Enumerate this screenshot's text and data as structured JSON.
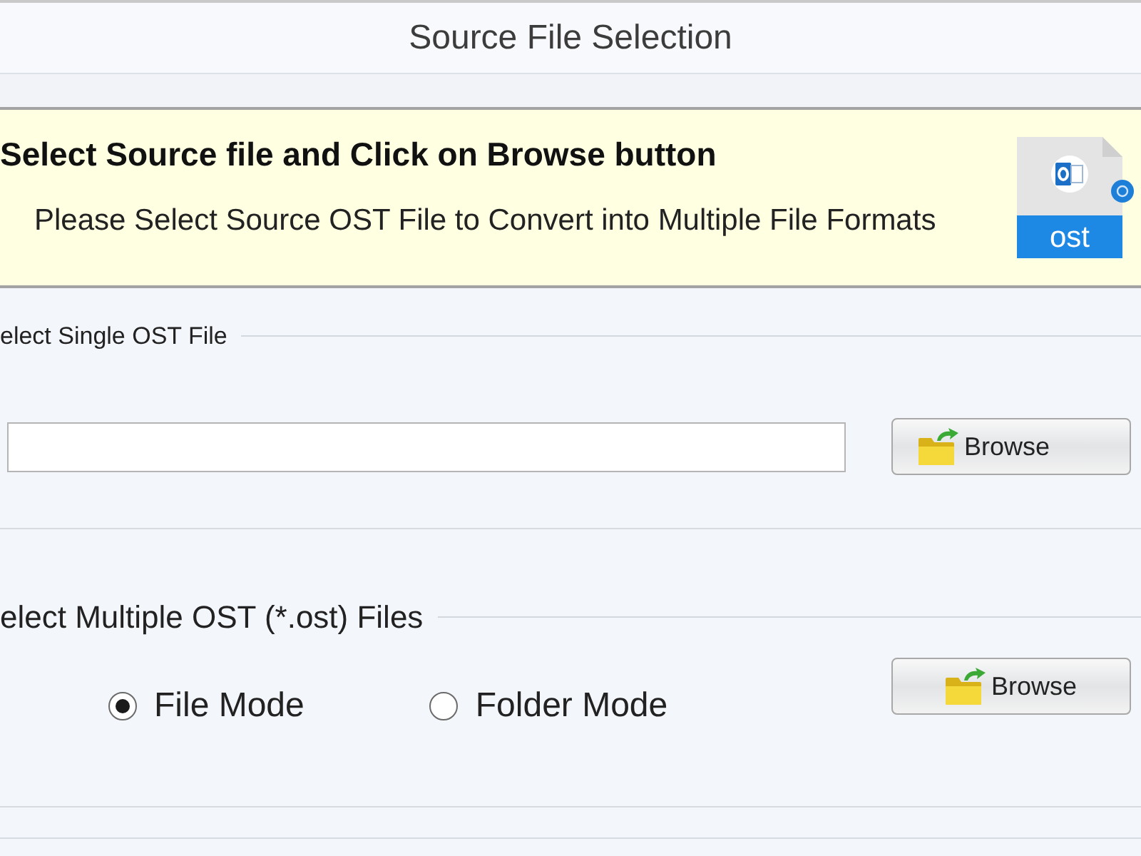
{
  "window": {
    "title": "Source File Selection"
  },
  "banner": {
    "heading": "Select Source file and Click on Browse button",
    "message": "Please Select Source OST File to Convert into Multiple File Formats",
    "file_type": "ost"
  },
  "single_file": {
    "label": "elect Single OST File",
    "browse_button": "Browse"
  },
  "multiple_files": {
    "label": "elect Multiple OST (*.ost) Files",
    "modes": [
      {
        "label": "File Mode",
        "selected": true
      },
      {
        "label": "Folder Mode",
        "selected": false
      }
    ],
    "browse_button": "Browse"
  }
}
